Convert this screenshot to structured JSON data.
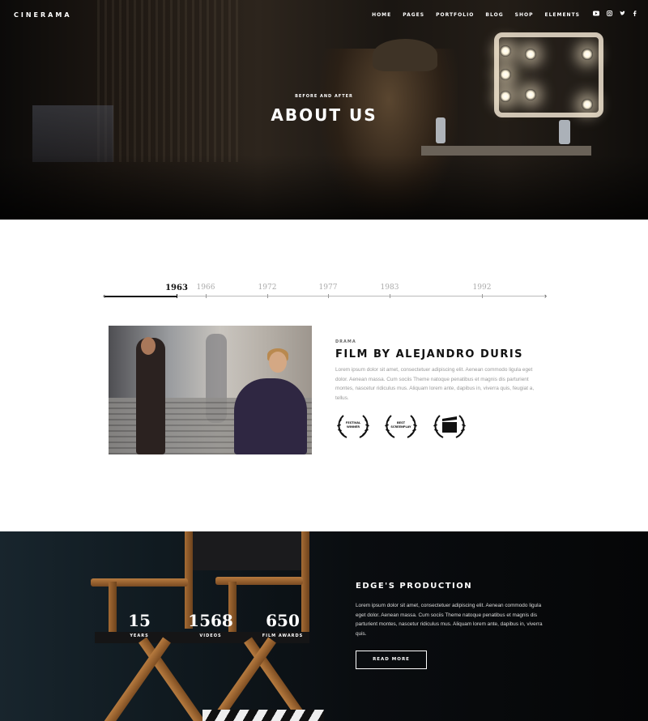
{
  "brand": {
    "logo": "CINERAMA"
  },
  "nav": {
    "items": [
      "HOME",
      "PAGES",
      "PORTFOLIO",
      "BLOG",
      "SHOP",
      "ELEMENTS"
    ],
    "social": [
      "youtube-icon",
      "instagram-icon",
      "twitter-icon",
      "facebook-icon"
    ]
  },
  "hero": {
    "subtitle": "BEFORE AND AFTER",
    "title": "ABOUT US"
  },
  "timeline": {
    "years": [
      "1963",
      "1966",
      "1972",
      "1977",
      "1983",
      "1992"
    ],
    "active": "1963"
  },
  "film": {
    "category": "DRAMA",
    "title": "FILM BY ALEJANDRO DURIS",
    "text": "Lorem ipsum dolor sit amet, consectetuer adipiscing elit. Aenean commodo ligula eget dolor. Aenean massa. Cum sociis Theme natoque penatibus et magnis dis parturient montes, nascetur ridiculus mus. Aliquam lorem ante, dapibus in, viverra quis, feugiat a, tellus.",
    "awards": [
      {
        "label1": "FESTIVAL",
        "label2": "WINNER"
      },
      {
        "label1": "BEST",
        "label2": "SCREENPLAY"
      },
      {
        "label1": "",
        "label2": ""
      }
    ]
  },
  "production": {
    "stats": [
      {
        "num": "15",
        "label": "YEARS"
      },
      {
        "num": "1568",
        "label": "VIDEOS"
      },
      {
        "num": "650",
        "label": "FILM AWARDS"
      }
    ],
    "title": "EDGE'S PRODUCTION",
    "text": "Lorem ipsum dolor sit amet, consectetuer adipiscing elit. Aenean commodo ligula eget dolor. Aenean massa. Cum sociis Theme natoque penatibus et magnis dis parturient montes, nascetur ridiculus mus. Aliquam lorem ante, dapibus in, viverra quis.",
    "button": "READ MORE"
  }
}
